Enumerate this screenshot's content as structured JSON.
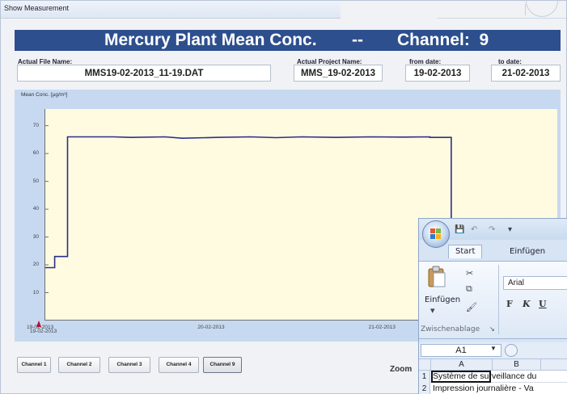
{
  "window": {
    "title": "Show Measurement"
  },
  "banner": {
    "title": "Mercury Plant Mean Conc.",
    "separator": "--",
    "channel_text": "Channel:  9"
  },
  "fields": {
    "file_label": "Actual File Name:",
    "file_value": "MMS19-02-2013_11-19.DAT",
    "project_label": "Actual Project Name:",
    "project_value": "MMS_19-02-2013",
    "from_label": "from date:",
    "from_value": "19-02-2013",
    "to_label": "to date:",
    "to_value": "21-02-2013"
  },
  "chart_data": {
    "type": "line",
    "ylabel": "Mean Conc. [µg/m³]",
    "yticks": [
      "10",
      "20",
      "30",
      "40",
      "50",
      "60",
      "70"
    ],
    "ylim": [
      0,
      76
    ],
    "xticks": [
      "19-02-2013",
      "20-02-2013",
      "21-02-2013"
    ],
    "xlim": [
      0,
      60
    ],
    "grid": false,
    "series": [
      {
        "color": "#2b2f8c",
        "points": [
          [
            0,
            19
          ],
          [
            1.1,
            19
          ],
          [
            1.1,
            23
          ],
          [
            2.6,
            23
          ],
          [
            2.6,
            66
          ],
          [
            8,
            66
          ],
          [
            10,
            65.8
          ],
          [
            14,
            66
          ],
          [
            16,
            65.5
          ],
          [
            20,
            65.8
          ],
          [
            24,
            66
          ],
          [
            27,
            65.7
          ],
          [
            30,
            66
          ],
          [
            34,
            65.8
          ],
          [
            38,
            66
          ],
          [
            42,
            65.9
          ],
          [
            45,
            66
          ],
          [
            45,
            65.8
          ],
          [
            47.5,
            65.8
          ],
          [
            47.5,
            26
          ],
          [
            50.5,
            26
          ],
          [
            50.5,
            1.2
          ],
          [
            53,
            1.3
          ],
          [
            56,
            1
          ],
          [
            60,
            1.2
          ]
        ]
      }
    ]
  },
  "marker_date": "19-02-2013",
  "channel_buttons": [
    "Channel 1",
    "Channel 2",
    "Channel 3",
    "Channel 4",
    "Channel 9"
  ],
  "zoom_label": "Zoom",
  "excel": {
    "tabs": [
      "Start",
      "Einfügen"
    ],
    "paste_label": "Einfügen",
    "clipboard_group": "Zwischenablage",
    "font_name": "Arial",
    "format_buttons": [
      "F",
      "K",
      "U"
    ],
    "name_box": "A1",
    "columns": [
      "A",
      "B"
    ],
    "rows": [
      {
        "num": "1",
        "text": "Système de surveillance du"
      },
      {
        "num": "2",
        "text": "Impression journalière - Va"
      }
    ]
  }
}
